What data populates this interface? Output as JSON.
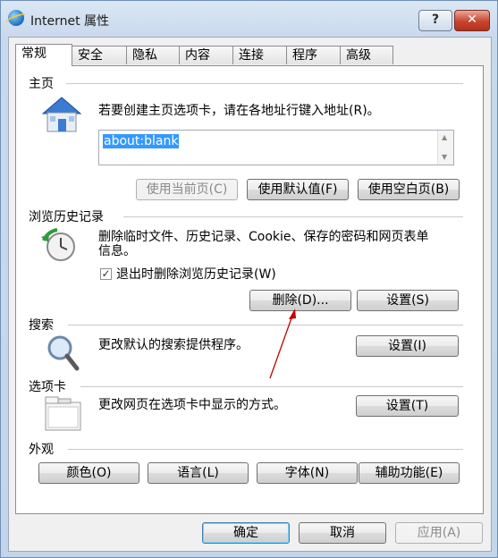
{
  "window": {
    "title": "Internet 属性",
    "help_label": "?",
    "close_label": "✕"
  },
  "tabs": [
    {
      "label": "常规"
    },
    {
      "label": "安全"
    },
    {
      "label": "隐私"
    },
    {
      "label": "内容"
    },
    {
      "label": "连接"
    },
    {
      "label": "程序"
    },
    {
      "label": "高级"
    }
  ],
  "home": {
    "heading": "主页",
    "description": "若要创建主页选项卡，请在各地址行键入地址(R)。",
    "address_value": "about:blank",
    "use_current_label": "使用当前页(C)",
    "use_default_label": "使用默认值(F)",
    "use_blank_label": "使用空白页(B)"
  },
  "history": {
    "heading": "浏览历史记录",
    "description_line1": "删除临时文件、历史记录、Cookie、保存的密码和网页表单",
    "description_line2": "信息。",
    "checkbox_label": "退出时删除浏览历史记录(W)",
    "checkbox_checked": true,
    "delete_label": "删除(D)...",
    "settings_label": "设置(S)"
  },
  "search": {
    "heading": "搜索",
    "description": "更改默认的搜索提供程序。",
    "settings_label": "设置(I)"
  },
  "tabs_section": {
    "heading": "选项卡",
    "description": "更改网页在选项卡中显示的方式。",
    "settings_label": "设置(T)"
  },
  "appearance": {
    "heading": "外观",
    "colors_label": "颜色(O)",
    "languages_label": "语言(L)",
    "fonts_label": "字体(N)",
    "accessibility_label": "辅助功能(E)"
  },
  "footer": {
    "ok_label": "确定",
    "cancel_label": "取消",
    "apply_label": "应用(A)"
  },
  "colors": {
    "annotation_arrow": "#c00000",
    "selection": "#3399ff"
  }
}
